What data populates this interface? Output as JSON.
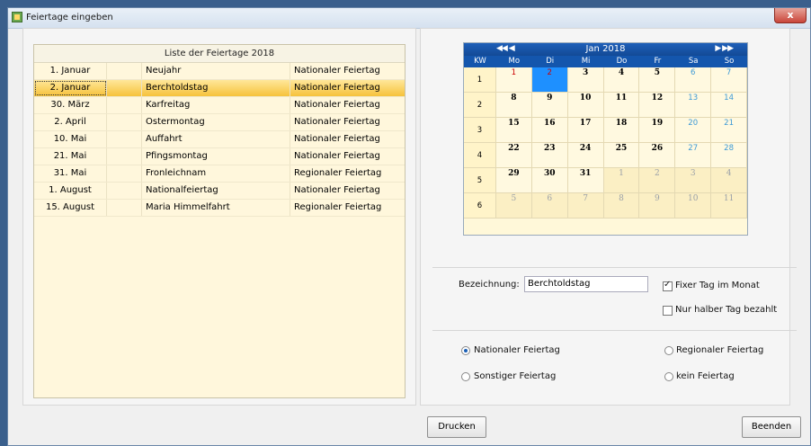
{
  "window": {
    "title": "Feiertage eingeben",
    "close_label": "x"
  },
  "list": {
    "title": "Liste der Feiertage 2018",
    "rows": [
      {
        "date": "1. Januar",
        "name": "Neujahr",
        "type": "Nationaler Feiertag"
      },
      {
        "date": "2. Januar",
        "name": "Berchtoldstag",
        "type": "Nationaler Feiertag"
      },
      {
        "date": "30. März",
        "name": "Karfreitag",
        "type": "Nationaler Feiertag"
      },
      {
        "date": "2. April",
        "name": "Ostermontag",
        "type": "Nationaler Feiertag"
      },
      {
        "date": "10. Mai",
        "name": "Auffahrt",
        "type": "Nationaler Feiertag"
      },
      {
        "date": "21. Mai",
        "name": "Pfingsmontag",
        "type": "Nationaler Feiertag"
      },
      {
        "date": "31. Mai",
        "name": "Fronleichnam",
        "type": "Regionaler Feiertag"
      },
      {
        "date": "1. August",
        "name": "Nationalfeiertag",
        "type": "Nationaler Feiertag"
      },
      {
        "date": "15. August",
        "name": "Maria Himmelfahrt",
        "type": "Regionaler Feiertag"
      }
    ],
    "selected_index": 1
  },
  "calendar": {
    "month_label": "Jan 2018",
    "prev_label": "◀◀ ◀",
    "next_label": "▶ ▶▶",
    "headers": [
      "KW",
      "Mo",
      "Di",
      "Mi",
      "Do",
      "Fr",
      "Sa",
      "So"
    ],
    "weeks": [
      {
        "kw": "1",
        "days": [
          "1",
          "2",
          "3",
          "4",
          "5",
          "6",
          "7"
        ]
      },
      {
        "kw": "2",
        "days": [
          "8",
          "9",
          "10",
          "11",
          "12",
          "13",
          "14"
        ]
      },
      {
        "kw": "3",
        "days": [
          "15",
          "16",
          "17",
          "18",
          "19",
          "20",
          "21"
        ]
      },
      {
        "kw": "4",
        "days": [
          "22",
          "23",
          "24",
          "25",
          "26",
          "27",
          "28"
        ]
      },
      {
        "kw": "5",
        "days": [
          "29",
          "30",
          "31",
          "1",
          "2",
          "3",
          "4"
        ]
      },
      {
        "kw": "6",
        "days": [
          "5",
          "6",
          "7",
          "8",
          "9",
          "10",
          "11"
        ]
      }
    ],
    "selected_day": "2",
    "holiday_days": [
      "1",
      "2"
    ]
  },
  "form": {
    "bezeichnung_label": "Bezeichnung:",
    "bezeichnung_value": "Berchtoldstag",
    "fixer_tag_label": "Fixer Tag im Monat",
    "fixer_tag_checked": true,
    "halber_tag_label": "Nur halber Tag bezahlt",
    "halber_tag_checked": false
  },
  "types": {
    "national": "Nationaler Feiertag",
    "regional": "Regionaler Feiertag",
    "sonstiger": "Sonstiger Feiertag",
    "kein": "kein Feiertag",
    "selected": "national"
  },
  "buttons": {
    "print": "Drucken",
    "close": "Beenden"
  }
}
